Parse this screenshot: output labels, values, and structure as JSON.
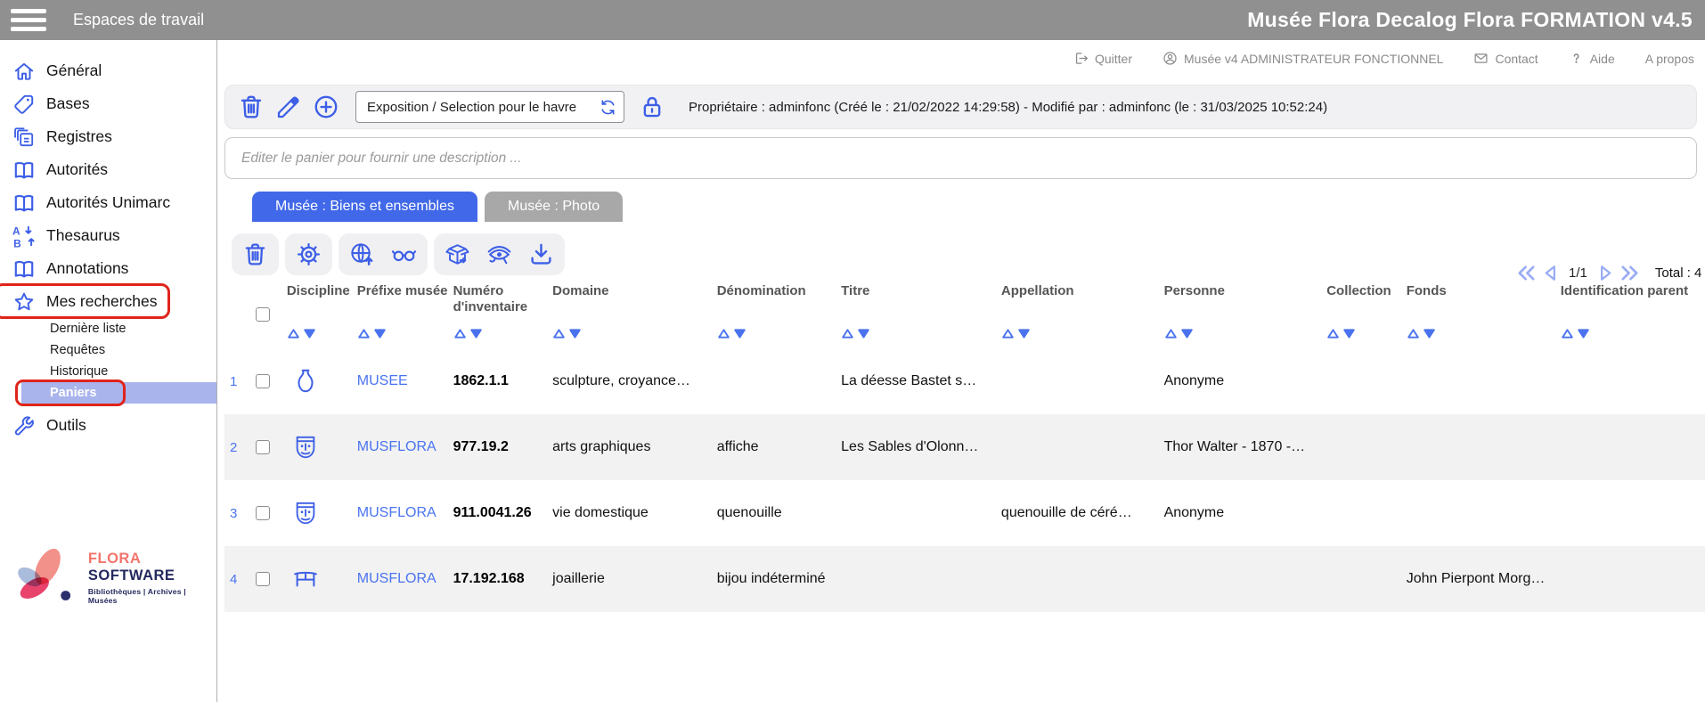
{
  "topbar": {
    "workspace_label": "Espaces de travail",
    "title": "Musée Flora Decalog Flora FORMATION v4.5"
  },
  "sidebar": {
    "main_items": [
      {
        "label": "Général",
        "icon": "home-icon"
      },
      {
        "label": "Bases",
        "icon": "tag-icon"
      },
      {
        "label": "Registres",
        "icon": "copies-icon"
      },
      {
        "label": "Autorités",
        "icon": "book-icon"
      },
      {
        "label": "Autorités Unimarc",
        "icon": "book-icon"
      },
      {
        "label": "Thesaurus",
        "icon": "sort-az-icon"
      },
      {
        "label": "Annotations",
        "icon": "book-icon"
      },
      {
        "label": "Mes recherches",
        "icon": "star-icon",
        "annotated": true
      }
    ],
    "sub_items": [
      {
        "label": "Dernière liste"
      },
      {
        "label": "Requêtes"
      },
      {
        "label": "Historique"
      },
      {
        "label": "Paniers",
        "selected": true,
        "annotated": true
      }
    ],
    "bottom_items": [
      {
        "label": "Outils",
        "icon": "wrench-icon"
      }
    ],
    "logo": {
      "brand_primary": "FLORA",
      "brand_secondary": "SOFTWARE",
      "tagline": "Bibliothèques | Archives | Musées"
    }
  },
  "header_links": [
    {
      "label": "Quitter",
      "icon": "exit-icon"
    },
    {
      "label": "Musée v4 ADMINISTRATEUR FONCTIONNEL",
      "icon": "user-icon"
    },
    {
      "label": "Contact",
      "icon": "envelope-icon"
    },
    {
      "label": "Aide",
      "icon": "question-icon"
    },
    {
      "label": "A propos"
    }
  ],
  "basket_toolbar": {
    "icons": [
      "trash-icon",
      "pencil-icon",
      "plus-circle-icon"
    ],
    "selector_value": "Exposition / Selection pour le havre",
    "refresh_icon": "refresh-icon",
    "lock_icon": "lock-icon",
    "owner_info": "Propriétaire : adminfonc (Créé le : 21/02/2022 14:29:58) - Modifié par : adminfonc (le : 31/03/2025 10:52:24)"
  },
  "description_input": {
    "placeholder": "Editer le panier pour fournir une description ..."
  },
  "tabs": [
    {
      "label": "Musée : Biens et ensembles",
      "active": true
    },
    {
      "label": "Musée : Photo",
      "active": false
    }
  ],
  "results_toolbar": {
    "groups": [
      [
        "trash-icon"
      ],
      [
        "gear-icon"
      ],
      [
        "globe-upload-icon",
        "glasses-icon"
      ],
      [
        "unbox-icon",
        "eye-of-horus-icon",
        "download-icon"
      ]
    ]
  },
  "pagination": {
    "page": "1/1",
    "total_label": "Total : 4",
    "icons": [
      "pg-first-icon",
      "pg-prev-icon",
      "pg-next-icon",
      "pg-last-icon"
    ]
  },
  "table": {
    "columns": [
      "Discipline",
      "Préfixe musée",
      "Numéro d'inventaire",
      "Domaine",
      "Dénomination",
      "Titre",
      "Appellation",
      "Personne",
      "Collection",
      "Fonds",
      "Identification parent"
    ],
    "rows": [
      {
        "num": "1",
        "discipline_icon": "amphora-icon",
        "prefixe": "MUSEE",
        "numero": "1862.1.1",
        "domaine": "sculpture, croyance…",
        "denomination": "",
        "titre": "La déesse Bastet s…",
        "appellation": "",
        "personne": "Anonyme",
        "collection": "",
        "fonds": "",
        "identification_parent": ""
      },
      {
        "num": "2",
        "discipline_icon": "mask-icon",
        "prefixe": "MUSFLORA",
        "numero": "977.19.2",
        "domaine": "arts graphiques",
        "denomination": "affiche",
        "titre": "Les Sables d'Olonn…",
        "appellation": "",
        "personne": "Thor Walter - 1870 -…",
        "collection": "",
        "fonds": "",
        "identification_parent": ""
      },
      {
        "num": "3",
        "discipline_icon": "mask-icon",
        "prefixe": "MUSFLORA",
        "numero": "911.0041.26",
        "domaine": "vie domestique",
        "denomination": "quenouille",
        "titre": "",
        "appellation": "quenouille de céré…",
        "personne": "Anonyme",
        "collection": "",
        "fonds": "",
        "identification_parent": ""
      },
      {
        "num": "4",
        "discipline_icon": "furniture-icon",
        "prefixe": "MUSFLORA",
        "numero": "17.192.168",
        "domaine": "joaillerie",
        "denomination": "bijou indéterminé",
        "titre": "",
        "appellation": "",
        "personne": "",
        "collection": "",
        "fonds": "John Pierpont Morg…",
        "identification_parent": ""
      }
    ]
  },
  "colors": {
    "accent_blue": "#3d5fe6",
    "link_blue": "#4a74f0",
    "selected_bg": "#a9b4ed",
    "annotation_red": "#df241b",
    "topbar_gray": "#909090",
    "tab_inactive_gray": "#a8a8a8",
    "row_alt_gray": "#f2f2f2",
    "pagination_blue": "#9aadf4"
  }
}
